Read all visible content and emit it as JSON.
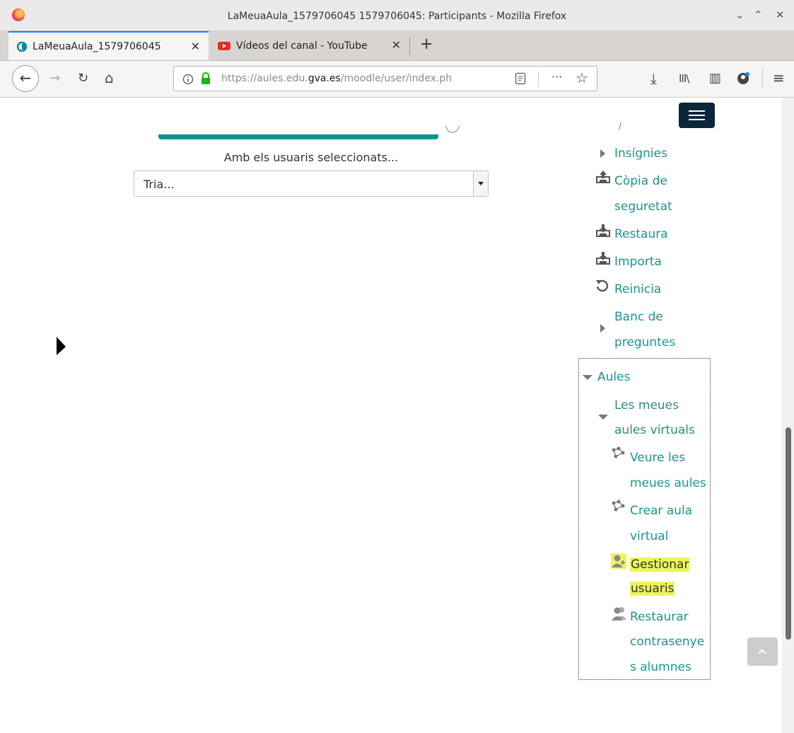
{
  "window": {
    "title": "LaMeuaAula_1579706045 1579706045: Participants - Mozilla Firefox",
    "controls": {
      "minimize": "⌄",
      "maximize": "⌃",
      "close": "✕"
    }
  },
  "tabs": [
    {
      "title": "LaMeuaAula_1579706045",
      "close": "✕"
    },
    {
      "title": "Vídeos del canal - YouTube",
      "close": "✕"
    }
  ],
  "newtab": "+",
  "navbar": {
    "back": "←",
    "forward": "→",
    "reload": "↻",
    "home": "⌂",
    "url_prefix": "https://aules.edu.",
    "url_domain": "gva.es",
    "url_rest": "/moodle/user/index.ph",
    "page_actions": "···",
    "bookmark": "☆",
    "download": "⤓",
    "library": "III\\",
    "sidebar": "▥",
    "account": "●",
    "menu": "≡"
  },
  "main": {
    "bulk_label": "Amb els usuaris seleccionats...",
    "select_value": "Tria..."
  },
  "sidebar": {
    "partial_item": "/",
    "items": [
      {
        "icon": "caret-right-icon",
        "label": "Insígnies"
      },
      {
        "icon": "upload-icon",
        "label_line1": "Còpia de",
        "label_line2": "seguretat"
      },
      {
        "icon": "download-icon",
        "label": "Restaura"
      },
      {
        "icon": "download-icon",
        "label": "Importa"
      },
      {
        "icon": "reset-icon",
        "label": "Reinicia"
      },
      {
        "icon": "caret-right-icon",
        "label_line1": "Banc de",
        "label_line2": "preguntes"
      }
    ],
    "aules": {
      "label": "Aules",
      "section": {
        "label_line1": "Les meues",
        "label_line2": "aules virtuals"
      },
      "children": [
        {
          "icon": "network-icon",
          "label_line1": "Veure les",
          "label_line2": "meues aules"
        },
        {
          "icon": "network-icon",
          "label_line1": "Crear aula",
          "label_line2": "virtual"
        },
        {
          "icon": "user-admin-icon",
          "label_line1": "Gestionar",
          "label_line2": "usuaris"
        },
        {
          "icon": "users-icon",
          "label_line1": "Restaurar",
          "label_line2": "contrasenye",
          "label_line3": "s alumnes"
        }
      ]
    }
  },
  "colors": {
    "accent": "#009688",
    "link": "#1a958d",
    "navbar": "#0c2639",
    "highlight": "#ecf55a"
  }
}
